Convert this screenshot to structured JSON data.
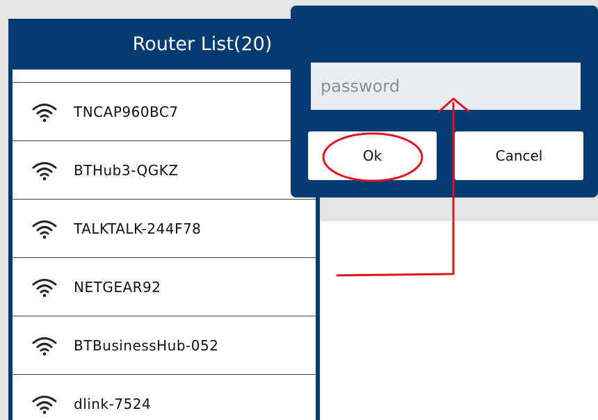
{
  "router_list": {
    "title": "Router List(20)",
    "items": [
      {
        "label": "TNCAP960BC7",
        "icon": "wifi-icon"
      },
      {
        "label": "BTHub3-QGKZ",
        "icon": "wifi-icon"
      },
      {
        "label": "TALKTALK-244F78",
        "icon": "wifi-icon"
      },
      {
        "label": "NETGEAR92",
        "icon": "wifi-icon"
      },
      {
        "label": "BTBusinessHub-052",
        "icon": "wifi-icon"
      },
      {
        "label": "dlink-7524",
        "icon": "wifi-icon"
      }
    ]
  },
  "password_dialog": {
    "placeholder": "password",
    "value": "",
    "ok_label": "Ok",
    "cancel_label": "Cancel"
  },
  "colors": {
    "header_blue": "#063a73",
    "annotation_red": "#e0141e",
    "background_gray": "#e4e4e4"
  }
}
